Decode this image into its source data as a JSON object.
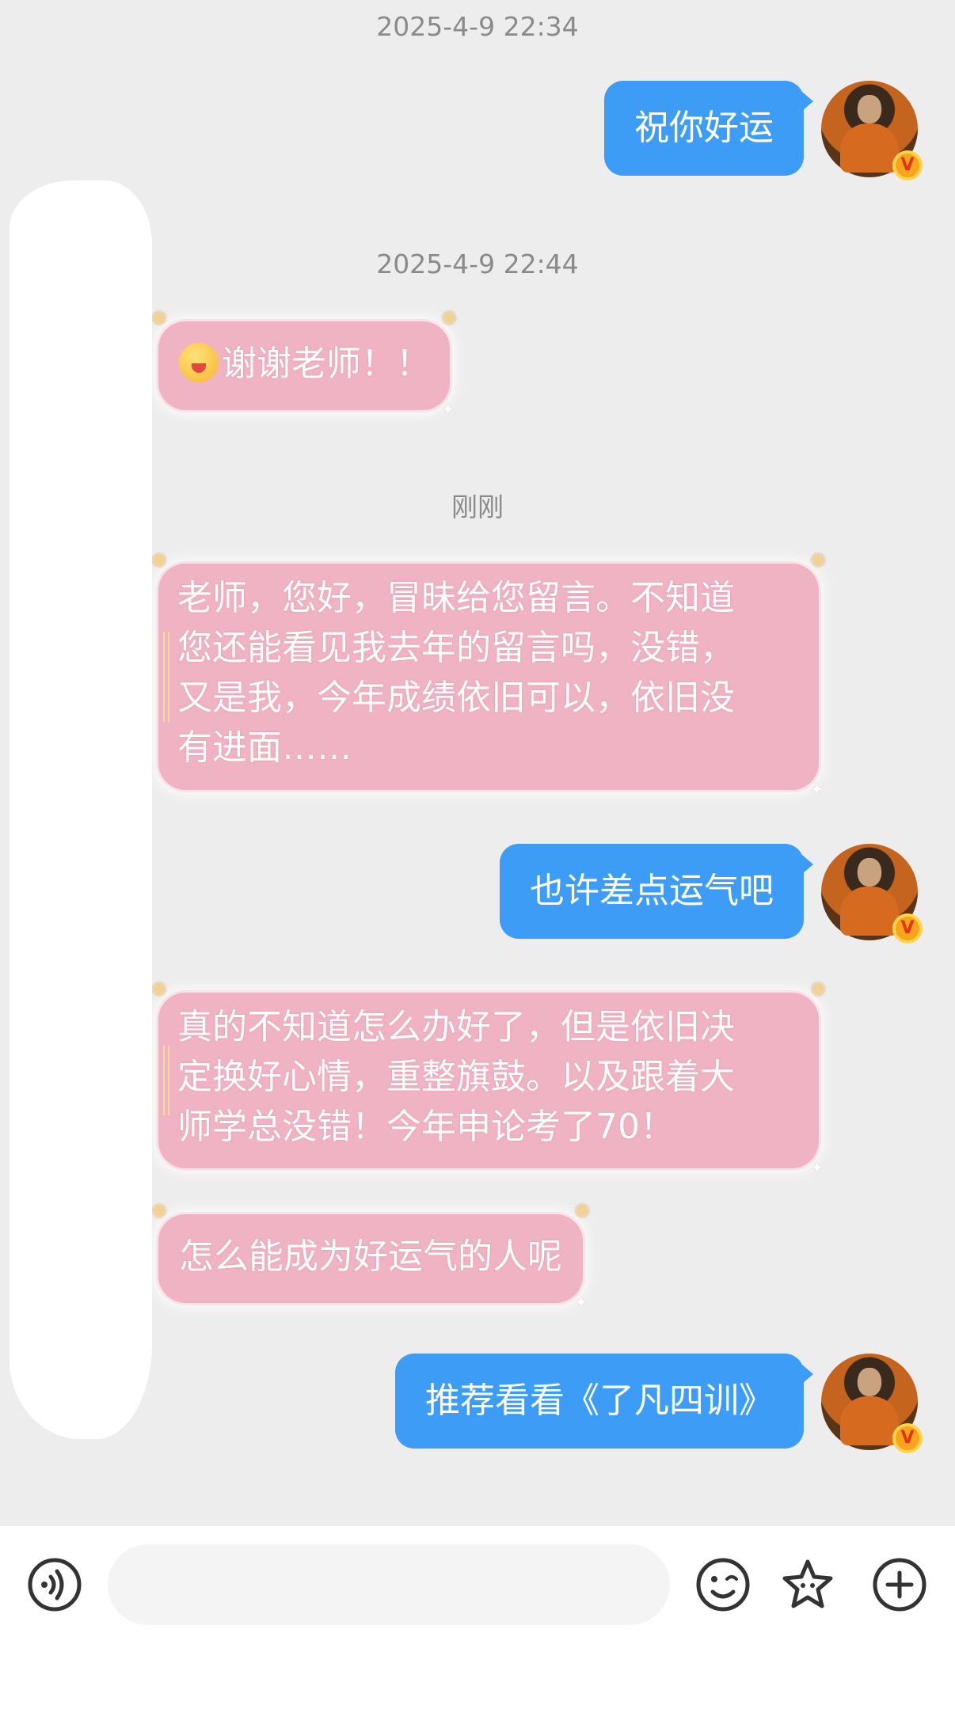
{
  "chat": {
    "timestamps": [
      "2025-4-9 22:34",
      "2025-4-9 22:44",
      "刚刚"
    ],
    "messages": [
      {
        "side": "outgoing",
        "text": "祝你好运"
      },
      {
        "side": "incoming",
        "emoji": "face-with-flower-emoji",
        "text": "谢谢老师！！"
      },
      {
        "side": "incoming",
        "lines": [
          "老师，您好，冒昧给您留言。不知道",
          "您还能看见我去年的留言吗，没错，",
          "又是我，今年成绩依旧可以，依旧没",
          "有进面……"
        ]
      },
      {
        "side": "outgoing",
        "text": "也许差点运气吧"
      },
      {
        "side": "incoming",
        "lines": [
          "真的不知道怎么办好了，但是依旧决",
          "定换好心情，重整旗鼓。以及跟着大",
          "师学总没错！今年申论考了70！"
        ]
      },
      {
        "side": "incoming",
        "text": "怎么能成为好运气的人呢"
      },
      {
        "side": "outgoing",
        "text": "推荐看看《了凡四训》"
      }
    ],
    "avatar_badge": "V"
  },
  "input_bar": {
    "voice_icon": "voice-wave-icon",
    "input_placeholder": "",
    "emoji_icon": "smiley-icon",
    "sticker_icon": "star-sticker-icon",
    "more_icon": "plus-circle-icon"
  },
  "colors": {
    "outgoing_bubble": "#3d9df6",
    "incoming_bubble": "#f0b3c4",
    "background": "#ededed",
    "timestamp": "#8a8a8a",
    "badge": "#f7a51a"
  }
}
